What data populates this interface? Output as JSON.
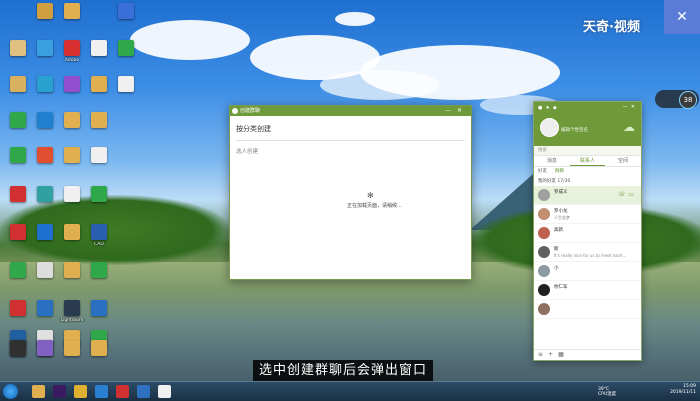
{
  "watermark": {
    "brand_text": "天奇·视频",
    "logo_glyph": "✕"
  },
  "desktop_icons": [
    {
      "label": "",
      "color": "#d0a040"
    },
    {
      "label": "",
      "color": "#e0b050"
    },
    {
      "label": "",
      "color": "#3a6fd8"
    },
    {
      "label": "",
      "color": "#e0c080"
    },
    {
      "label": "",
      "color": "#3aa0e0"
    },
    {
      "label": "Adobe",
      "color": "#d83030"
    },
    {
      "label": "",
      "color": "#f0f0f0"
    },
    {
      "label": "",
      "color": "#2fa84a"
    },
    {
      "label": "",
      "color": "#d8b060"
    },
    {
      "label": "",
      "color": "#2aa0d0"
    },
    {
      "label": "",
      "color": "#9050d0"
    },
    {
      "label": "",
      "color": "#e0b050"
    },
    {
      "label": "",
      "color": "#f0f0f0"
    },
    {
      "label": "",
      "color": "#2fa84a"
    },
    {
      "label": "",
      "color": "#2080d0"
    },
    {
      "label": "",
      "color": "#e0b050"
    },
    {
      "label": "",
      "color": "#e0b050"
    },
    {
      "label": "",
      "color": "#2fa84a"
    },
    {
      "label": "",
      "color": "#e05030"
    },
    {
      "label": "",
      "color": "#e0b050"
    },
    {
      "label": "",
      "color": "#f0f0f0"
    },
    {
      "label": "",
      "color": "#d03030"
    },
    {
      "label": "",
      "color": "#30a0a0"
    },
    {
      "label": "",
      "color": "#f0f0f0"
    },
    {
      "label": "",
      "color": "#2fa84a"
    },
    {
      "label": "",
      "color": "#d03030"
    },
    {
      "label": "",
      "color": "#2070d0"
    },
    {
      "label": "",
      "color": "#e0b050"
    },
    {
      "label": "CAD",
      "color": "#2a5fb0"
    },
    {
      "label": "",
      "color": "#2fa84a"
    },
    {
      "label": "",
      "color": "#dddddd"
    },
    {
      "label": "",
      "color": "#e0b050"
    },
    {
      "label": "",
      "color": "#2fa84a"
    },
    {
      "label": "",
      "color": "#d03030"
    },
    {
      "label": "",
      "color": "#2a70c0"
    },
    {
      "label": "Lightroom",
      "color": "#2a3a50"
    },
    {
      "label": "",
      "color": "#2a70c0"
    },
    {
      "label": "",
      "color": "#2060a0"
    },
    {
      "label": "",
      "color": "#e0e0e0"
    },
    {
      "label": "",
      "color": "#e0b050"
    },
    {
      "label": "",
      "color": "#2fa84a"
    },
    {
      "label": "",
      "color": "#2070c0"
    },
    {
      "label": "",
      "color": "#e0b050"
    },
    {
      "label": "",
      "color": "#e0b050"
    },
    {
      "label": "",
      "color": "#e0b050"
    },
    {
      "label": "",
      "color": "#303030"
    },
    {
      "label": "",
      "color": "#8060c0"
    }
  ],
  "dialog": {
    "title": "创建群聊",
    "heading": "按分类创建",
    "subheading": "选人创建",
    "spinner_glyph": "✻",
    "loading_text": "正在加载页面，请稍候..."
  },
  "panel": {
    "user_name": "",
    "status_text": "编辑个性签名",
    "search_placeholder": "搜索",
    "tabs": [
      {
        "label": "消息",
        "active": false
      },
      {
        "label": "联系人",
        "active": true
      },
      {
        "label": "空间",
        "active": false
      }
    ],
    "subtabs": [
      {
        "label": "好友",
        "active": false
      },
      {
        "label": "群聊",
        "active": true
      }
    ],
    "group_header": "我的好友 17/30",
    "contacts": [
      {
        "name": "罗成义",
        "sig": "",
        "color": "#a0a0a0",
        "selected": true
      },
      {
        "name": "罗小龙",
        "sig": "人生若梦",
        "color": "#c09070",
        "selected": false
      },
      {
        "name": "高新",
        "sig": "",
        "color": "#c06050",
        "selected": false
      },
      {
        "name": "斯",
        "sig": "It's really nice for us to meet each...",
        "color": "#606060",
        "selected": false
      },
      {
        "name": "小",
        "sig": "",
        "color": "#8a9aa0",
        "selected": false
      },
      {
        "name": "你仁军",
        "sig": "",
        "color": "#202020",
        "selected": false
      },
      {
        "name": "",
        "sig": "",
        "color": "#907060",
        "selected": false
      }
    ]
  },
  "weather_widget": {
    "label_top": "",
    "label_bottom": "",
    "value": "38"
  },
  "baidu_text": "",
  "subtitle": "选中创建群聊后会弹出窗口",
  "taskbar": {
    "time": "15:09",
    "date": "2019/11/11",
    "temp_label": "39°C",
    "temp_sub": "CPU温度",
    "apps": [
      {
        "name": "folder-app",
        "color": "#e0b050"
      },
      {
        "name": "premiere-app",
        "color": "#3a1a60"
      },
      {
        "name": "chrome-app",
        "color": "#e0b030"
      },
      {
        "name": "browser-app",
        "color": "#2a80d0"
      },
      {
        "name": "wps-app",
        "color": "#d03030"
      },
      {
        "name": "tool-app",
        "color": "#3070c0"
      },
      {
        "name": "qq-app",
        "color": "#f0f0f0"
      }
    ]
  }
}
